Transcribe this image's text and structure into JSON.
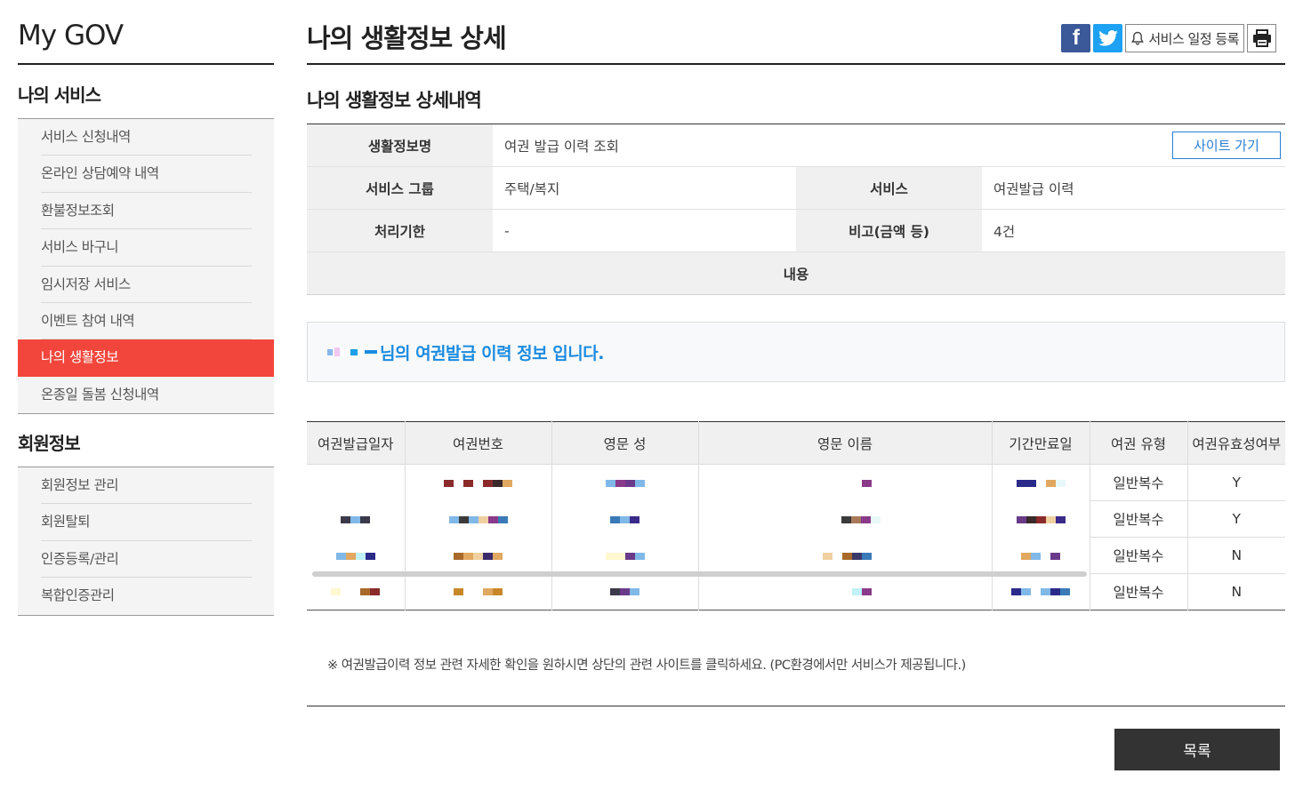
{
  "brand": "My GOV",
  "sidebar": {
    "my_services_title": "나의 서비스",
    "my_services": [
      {
        "label": "서비스 신청내역"
      },
      {
        "label": "온라인 상담예약 내역"
      },
      {
        "label": "환불정보조회"
      },
      {
        "label": "서비스 바구니"
      },
      {
        "label": "임시저장 서비스"
      },
      {
        "label": "이벤트 참여 내역"
      },
      {
        "label": "나의 생활정보",
        "active": true
      },
      {
        "label": "온종일 돌봄 신청내역"
      }
    ],
    "member_title": "회원정보",
    "member_items": [
      {
        "label": "회원정보 관리"
      },
      {
        "label": "회원탈퇴"
      },
      {
        "label": "인증등록/관리"
      },
      {
        "label": "복합인증관리"
      }
    ]
  },
  "header": {
    "title": "나의 생활정보 상세",
    "facebook_icon": "f",
    "schedule_label": "서비스 일정 등록"
  },
  "detail": {
    "title": "나의 생활정보 상세내역",
    "name_label": "생활정보명",
    "name_value": "여권 발급 이력 조회",
    "site_button": "사이트 가기",
    "group_label": "서비스 그룹",
    "group_value": "주택/복지",
    "service_label": "서비스",
    "service_value": "여권발급 이력",
    "deadline_label": "처리기한",
    "deadline_value": "-",
    "note_label": "비고(금액 등)",
    "note_value": "4건",
    "content_label": "내용"
  },
  "info": {
    "message": "님의 여권발급 이력 정보 입니다."
  },
  "passport_table": {
    "headers": [
      "여권발급일자",
      "여권번호",
      "영문 성",
      "영문 이름",
      "기간만료일",
      "여권 유형",
      "여권유효성여부"
    ],
    "rows": [
      {
        "type": "일반복수",
        "valid": "Y"
      },
      {
        "type": "일반복수",
        "valid": "Y"
      },
      {
        "type": "일반복수",
        "valid": "N"
      },
      {
        "type": "일반복수",
        "valid": "N"
      }
    ]
  },
  "notice": "※ 여권발급이력 정보 관련 자세한 확인을 원하시면 상단의 관련 사이트를 클릭하세요. (PC환경에서만 서비스가 제공됩니다.)",
  "list_button": "목록",
  "colors": {
    "active_menu": "#f2463c",
    "info_text": "#1a8be0",
    "site_button": "#2a7fd4",
    "facebook": "#3b5998",
    "twitter": "#1da1f2"
  }
}
